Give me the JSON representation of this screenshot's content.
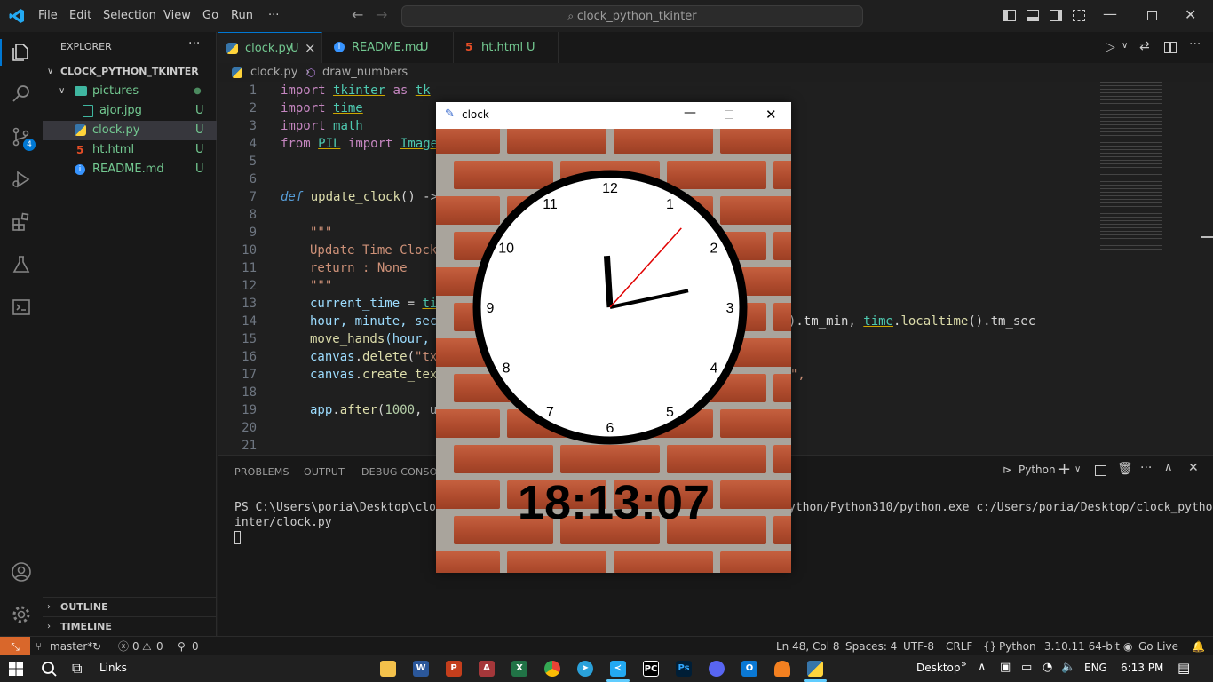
{
  "menu": {
    "items": [
      "File",
      "Edit",
      "Selection",
      "View",
      "Go",
      "Run",
      "···"
    ],
    "search": "clock_python_tkinter"
  },
  "sidebar": {
    "title": "EXPLORER",
    "more": "···",
    "root": "CLOCK_PYTHON_TKINTER",
    "items": [
      {
        "label": "pictures",
        "status": "●",
        "kind": "folder"
      },
      {
        "label": "ajor.jpg",
        "status": "U",
        "kind": "image"
      },
      {
        "label": "clock.py",
        "status": "U",
        "kind": "python"
      },
      {
        "label": "ht.html",
        "status": "U",
        "kind": "html"
      },
      {
        "label": "README.md",
        "status": "U",
        "kind": "info"
      }
    ],
    "outline": "OUTLINE",
    "timeline": "TIMELINE",
    "badge": "4"
  },
  "tabs": [
    {
      "label": "clock.py",
      "status": "U",
      "close": "×"
    },
    {
      "label": "README.md",
      "status": "U"
    },
    {
      "label": "ht.html",
      "status": "U"
    }
  ],
  "breadcrumb": {
    "file": "clock.py",
    "symbol": "draw_numbers"
  },
  "line_numbers": [
    "1",
    "2",
    "3",
    "4",
    "5",
    "6",
    "7",
    "8",
    "9",
    "10",
    "11",
    "12",
    "13",
    "14",
    "15",
    "16",
    "17",
    "18",
    "19",
    "20",
    "21"
  ],
  "code": {
    "l1": [
      "import",
      " ",
      "tkinter",
      " ",
      "as",
      " ",
      "tk"
    ],
    "l2": [
      "import",
      " ",
      "time"
    ],
    "l3": [
      "import",
      " ",
      "math"
    ],
    "l4": [
      "from",
      " ",
      "PIL",
      " ",
      "import",
      " ",
      "Image"
    ],
    "l7": [
      "def",
      " ",
      "update_clock",
      "() ->"
    ],
    "l9": "\"\"\"",
    "l10": "Update Time Clock",
    "l11": "return : None",
    "l12": "\"\"\"",
    "l13": [
      "current_time",
      " = ",
      "ti"
    ],
    "l14a": "hour, minute, sec",
    "l14b": [
      ").tm_min, ",
      "time",
      ".",
      "localtime",
      "().tm_sec"
    ],
    "l15": [
      "move_hands",
      "(hour,"
    ],
    "l16": [
      "canvas",
      ".",
      "delete",
      "(",
      "\"tx"
    ],
    "l17": [
      "canvas",
      ".",
      "create_tex"
    ],
    "l17b": "\",",
    "l19": [
      "app",
      ".",
      "after",
      "(",
      "1000",
      ", u"
    ]
  },
  "panel": {
    "tabs": [
      "PROBLEMS",
      "OUTPUT",
      "DEBUG CONSOLE"
    ],
    "shell": "Python",
    "terminal_line1a": "PS C:\\Users\\poria\\Desktop\\clock_p",
    "terminal_line1b": "ython/Python310/python.exe c:/Users/poria/Desktop/clock_python_tk",
    "terminal_line2": "inter/clock.py"
  },
  "statusbar": {
    "branch": "master*",
    "errors": "0",
    "warnings": "0",
    "ports": "0",
    "position": "Ln 48, Col 8",
    "spaces": "Spaces: 4",
    "encoding": "UTF-8",
    "eol": "CRLF",
    "language": "Python",
    "interpreter": "3.10.11 64-bit",
    "golive": "Go Live"
  },
  "taskbar": {
    "links": "Links",
    "desktop": "Desktop",
    "lang": "ENG",
    "time": "6:13 PM"
  },
  "clock_window": {
    "title": "clock",
    "digital_time": "18:13:07",
    "hour": 18,
    "minute": 13,
    "second": 7,
    "numbers": [
      "12",
      "1",
      "2",
      "3",
      "4",
      "5",
      "6",
      "7",
      "8",
      "9",
      "10",
      "11"
    ]
  },
  "colors": {
    "accent": "#0078d4",
    "remote": "#d9672b",
    "second_hand": "#e00000",
    "brick": "#b04c2e"
  }
}
